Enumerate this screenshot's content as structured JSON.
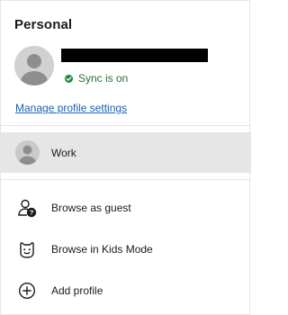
{
  "header": {
    "title": "Personal"
  },
  "current_profile": {
    "sync_status": "Sync is on",
    "manage_link": "Manage profile settings"
  },
  "other_profiles": [
    {
      "label": "Work"
    }
  ],
  "menu": {
    "items": [
      {
        "label": "Browse as guest",
        "icon": "guest-icon"
      },
      {
        "label": "Browse in Kids Mode",
        "icon": "kids-mode-icon"
      },
      {
        "label": "Add profile",
        "icon": "add-profile-icon"
      }
    ]
  },
  "colors": {
    "sync_green": "#1c8a3c",
    "link_blue": "#1a5fb4",
    "selected_row": "#e6e6e6"
  }
}
